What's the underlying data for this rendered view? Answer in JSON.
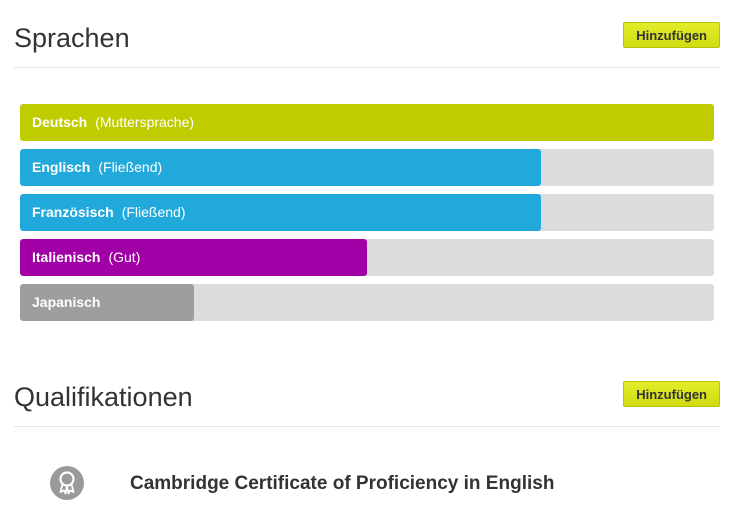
{
  "languages_section": {
    "title": "Sprachen",
    "add_label": "Hinzufügen",
    "items": [
      {
        "name": "Deutsch",
        "level": "(Muttersprache)",
        "fill": 1.0,
        "color": "#bfcc00"
      },
      {
        "name": "Englisch",
        "level": "(Fließend)",
        "fill": 0.75,
        "color": "#22a9dc"
      },
      {
        "name": "Französisch",
        "level": "(Fließend)",
        "fill": 0.75,
        "color": "#22a9dc"
      },
      {
        "name": "Italienisch",
        "level": "(Gut)",
        "fill": 0.5,
        "color": "#a000a6"
      },
      {
        "name": "Japanisch",
        "level": "",
        "fill": 0.25,
        "color": "#9e9e9e"
      }
    ]
  },
  "qualifications_section": {
    "title": "Qualifikationen",
    "add_label": "Hinzufügen",
    "items": [
      {
        "name": "Cambridge Certificate of Proficiency in English",
        "icon": "certificate-icon"
      }
    ]
  },
  "colors": {
    "accent": "#cfdc10",
    "track": "#dddddd"
  }
}
